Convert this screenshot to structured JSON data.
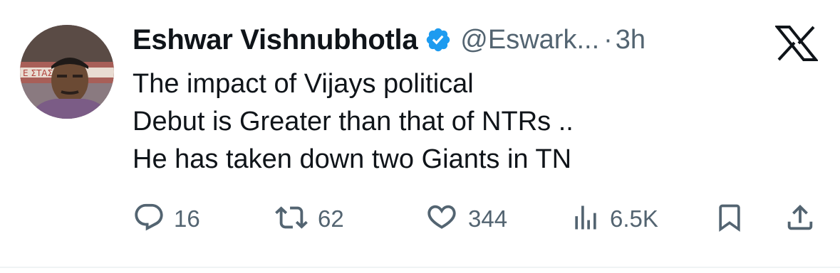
{
  "author": {
    "display_name": "Eshwar Vishnubhotla",
    "handle": "@Eswark...",
    "separator": "·",
    "time": "3h",
    "verified": true,
    "avatar_sign_text": "E  ΣΤΑΣΗ"
  },
  "tweet": {
    "lines": [
      "The impact of Vijays political",
      "Debut is Greater than that of NTRs ..",
      "He has taken down two Giants in TN"
    ]
  },
  "actions": {
    "replies": "16",
    "reposts": "62",
    "likes": "344",
    "views": "6.5K"
  },
  "icons": {
    "logo": "x-logo-icon",
    "verified": "verified-badge-icon",
    "reply": "reply-icon",
    "repost": "repost-icon",
    "like": "heart-icon",
    "views": "views-icon",
    "bookmark": "bookmark-icon",
    "share": "share-icon"
  },
  "colors": {
    "verified_blue": "#1d9bf0",
    "text_primary": "#0f1419",
    "text_secondary": "#536471"
  }
}
